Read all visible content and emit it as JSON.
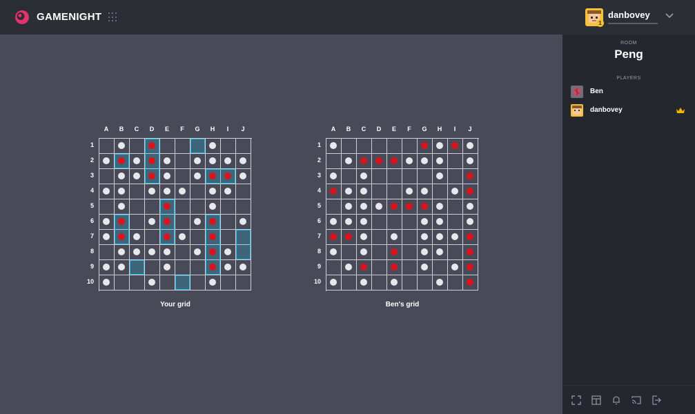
{
  "app": {
    "name": "GAMENIGHT"
  },
  "user": {
    "name": "danbovey",
    "level": "1"
  },
  "room": {
    "label": "ROOM",
    "name": "Peng"
  },
  "players": {
    "label": "PLAYERS",
    "items": [
      {
        "name": "Ben",
        "avatar": "ben-avatar",
        "host": false
      },
      {
        "name": "danbovey",
        "avatar": "danbovey-avatar",
        "host": true
      }
    ]
  },
  "columns": [
    "A",
    "B",
    "C",
    "D",
    "E",
    "F",
    "G",
    "H",
    "I",
    "J"
  ],
  "rows": [
    "1",
    "2",
    "3",
    "4",
    "5",
    "6",
    "7",
    "8",
    "9",
    "10"
  ],
  "your_grid": {
    "title": "Your grid",
    "ships": [
      "D1:D3",
      "G1:G1",
      "B2:B2",
      "H3:I3",
      "E5:E7",
      "B6:B7",
      "H6:H9",
      "J7:J8",
      "C9:C9",
      "F10:F10"
    ],
    "misses": [
      "B1",
      "H1",
      "A2",
      "C2",
      "E2",
      "G2",
      "H2",
      "I2",
      "J2",
      "B3",
      "C3",
      "E3",
      "G3",
      "J3",
      "A4",
      "B4",
      "D4",
      "E4",
      "F4",
      "H4",
      "I4",
      "B5",
      "H5",
      "A6",
      "D6",
      "G6",
      "J6",
      "A7",
      "C7",
      "F7",
      "B8",
      "C8",
      "D8",
      "E8",
      "G8",
      "I8",
      "A9",
      "B9",
      "E9",
      "I9",
      "J9",
      "A10",
      "D10",
      "H10"
    ],
    "hits": [
      "D1",
      "B2",
      "D2",
      "D3",
      "H3",
      "I3",
      "E5",
      "B6",
      "E6",
      "H6",
      "B7",
      "E7",
      "H7",
      "H8",
      "H9"
    ]
  },
  "ben_grid": {
    "title": "Ben's grid",
    "misses": [
      "A1",
      "H1",
      "J1",
      "B2",
      "F2",
      "G2",
      "H2",
      "J2",
      "A3",
      "C3",
      "H3",
      "B4",
      "C4",
      "F4",
      "G4",
      "I4",
      "B5",
      "C5",
      "D5",
      "H5",
      "J5",
      "A6",
      "B6",
      "C6",
      "G6",
      "H6",
      "J6",
      "C7",
      "E7",
      "G7",
      "H7",
      "I7",
      "A8",
      "C8",
      "G8",
      "H8",
      "B9",
      "G9",
      "I9",
      "A10",
      "C10",
      "E10",
      "H10"
    ],
    "hits": [
      "G1",
      "I1",
      "C2",
      "D2",
      "E2",
      "J3",
      "A4",
      "J4",
      "E5",
      "F5",
      "G5",
      "A7",
      "B7",
      "J7",
      "E8",
      "J8",
      "C9",
      "E9",
      "J9",
      "J10"
    ]
  }
}
